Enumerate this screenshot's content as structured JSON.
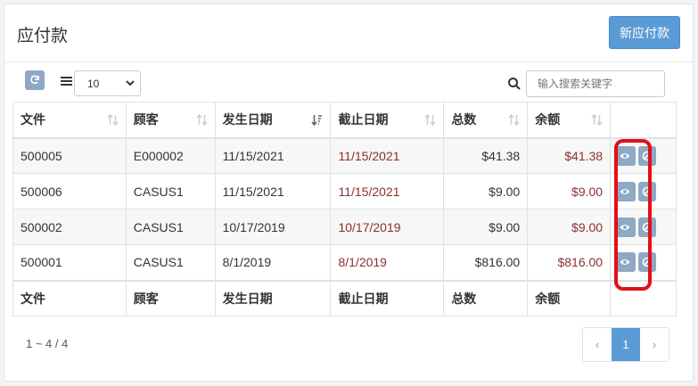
{
  "page": {
    "title": "应付款",
    "new_button": "新应付款"
  },
  "toolbar": {
    "page_size": "10",
    "search_placeholder": "输入搜索关键字"
  },
  "table": {
    "headers": [
      "文件",
      "顾客",
      "发生日期",
      "截止日期",
      "总数",
      "余额"
    ],
    "rows": [
      {
        "file": "500005",
        "customer": "E000002",
        "date": "11/15/2021",
        "due": "11/15/2021",
        "total": "$41.38",
        "balance": "$41.38"
      },
      {
        "file": "500006",
        "customer": "CASUS1",
        "date": "11/15/2021",
        "due": "11/15/2021",
        "total": "$9.00",
        "balance": "$9.00"
      },
      {
        "file": "500002",
        "customer": "CASUS1",
        "date": "10/17/2019",
        "due": "10/17/2019",
        "total": "$9.00",
        "balance": "$9.00"
      },
      {
        "file": "500001",
        "customer": "CASUS1",
        "date": "8/1/2019",
        "due": "8/1/2019",
        "total": "$816.00",
        "balance": "$816.00"
      }
    ],
    "footers": [
      "文件",
      "顾客",
      "发生日期",
      "截止日期",
      "总数",
      "余额"
    ]
  },
  "pagination": {
    "summary": "1 ~ 4 / 4",
    "prev": "‹",
    "current": "1",
    "next": "›"
  },
  "colors": {
    "primary": "#5b9bd5",
    "due_text": "#8b2f2f",
    "highlight": "#e0101a",
    "action_button": "#8fa8c4"
  }
}
